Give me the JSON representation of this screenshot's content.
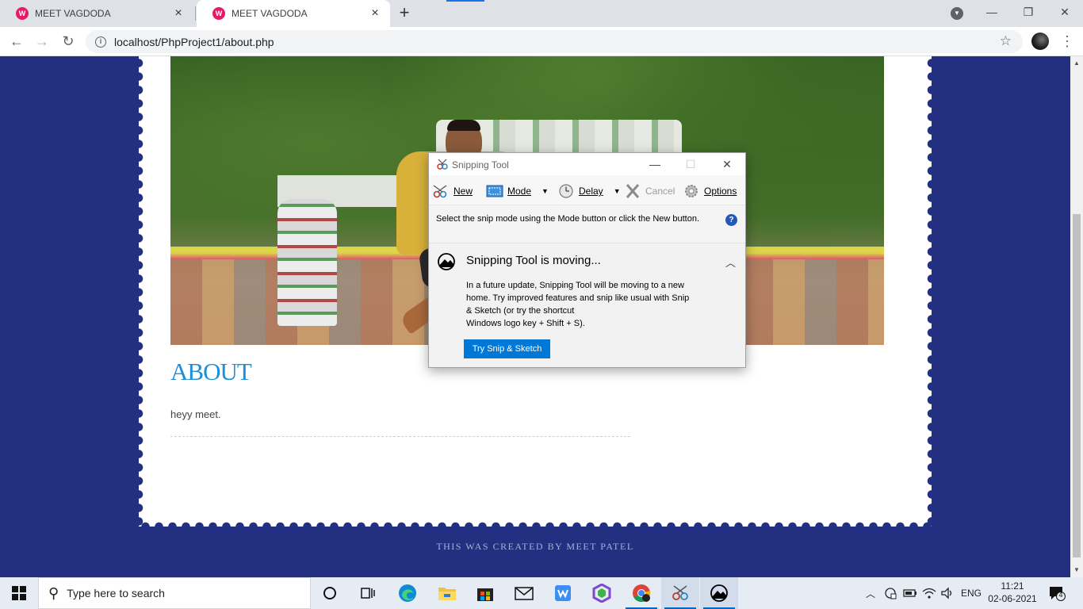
{
  "browser": {
    "tabs": [
      {
        "title": "MEET VAGDODA",
        "favicon": "W",
        "active": false
      },
      {
        "title": "MEET VAGDODA",
        "favicon": "W",
        "active": true
      }
    ],
    "tab_close_glyph": "×",
    "new_tab_glyph": "+",
    "url": "localhost/PhpProject1/about.php",
    "window_controls": {
      "minimize": "—",
      "restore": "❐",
      "close": "✕"
    }
  },
  "page": {
    "about_heading": "ABOUT",
    "about_text": "heyy meet.",
    "footer": "THIS WAS CREATED BY MEET PATEL",
    "colors": {
      "background": "#232f80",
      "heading": "#1d8fd6",
      "paper": "#ffffff"
    }
  },
  "snipping_tool": {
    "title": "Snipping Tool",
    "toolbar": {
      "new_label": "New",
      "mode_label": "Mode",
      "delay_label": "Delay",
      "cancel_label": "Cancel",
      "options_label": "Options"
    },
    "info_text": "Select the snip mode using the Mode button or click the New button.",
    "help_glyph": "?",
    "notice": {
      "heading": "Snipping Tool is moving...",
      "body_lines": [
        "In a future update, Snipping Tool will be moving to a new",
        "home. Try improved features and snip like usual with Snip",
        "& Sketch (or try the shortcut",
        "Windows logo key + Shift + S)."
      ],
      "button_label": "Try Snip & Sketch"
    }
  },
  "taskbar": {
    "search_placeholder": "Type here to search",
    "apps": [
      "cortana-icon",
      "task-view-icon",
      "edge-icon",
      "file-explorer-icon",
      "store-icon",
      "mail-icon",
      "wps-icon",
      "nodejs-icon",
      "chrome-icon",
      "snipping-tool-icon",
      "snip-sketch-icon"
    ],
    "language": "ENG",
    "time": "11:21",
    "date": "02-06-2021",
    "notification_count": "4"
  }
}
